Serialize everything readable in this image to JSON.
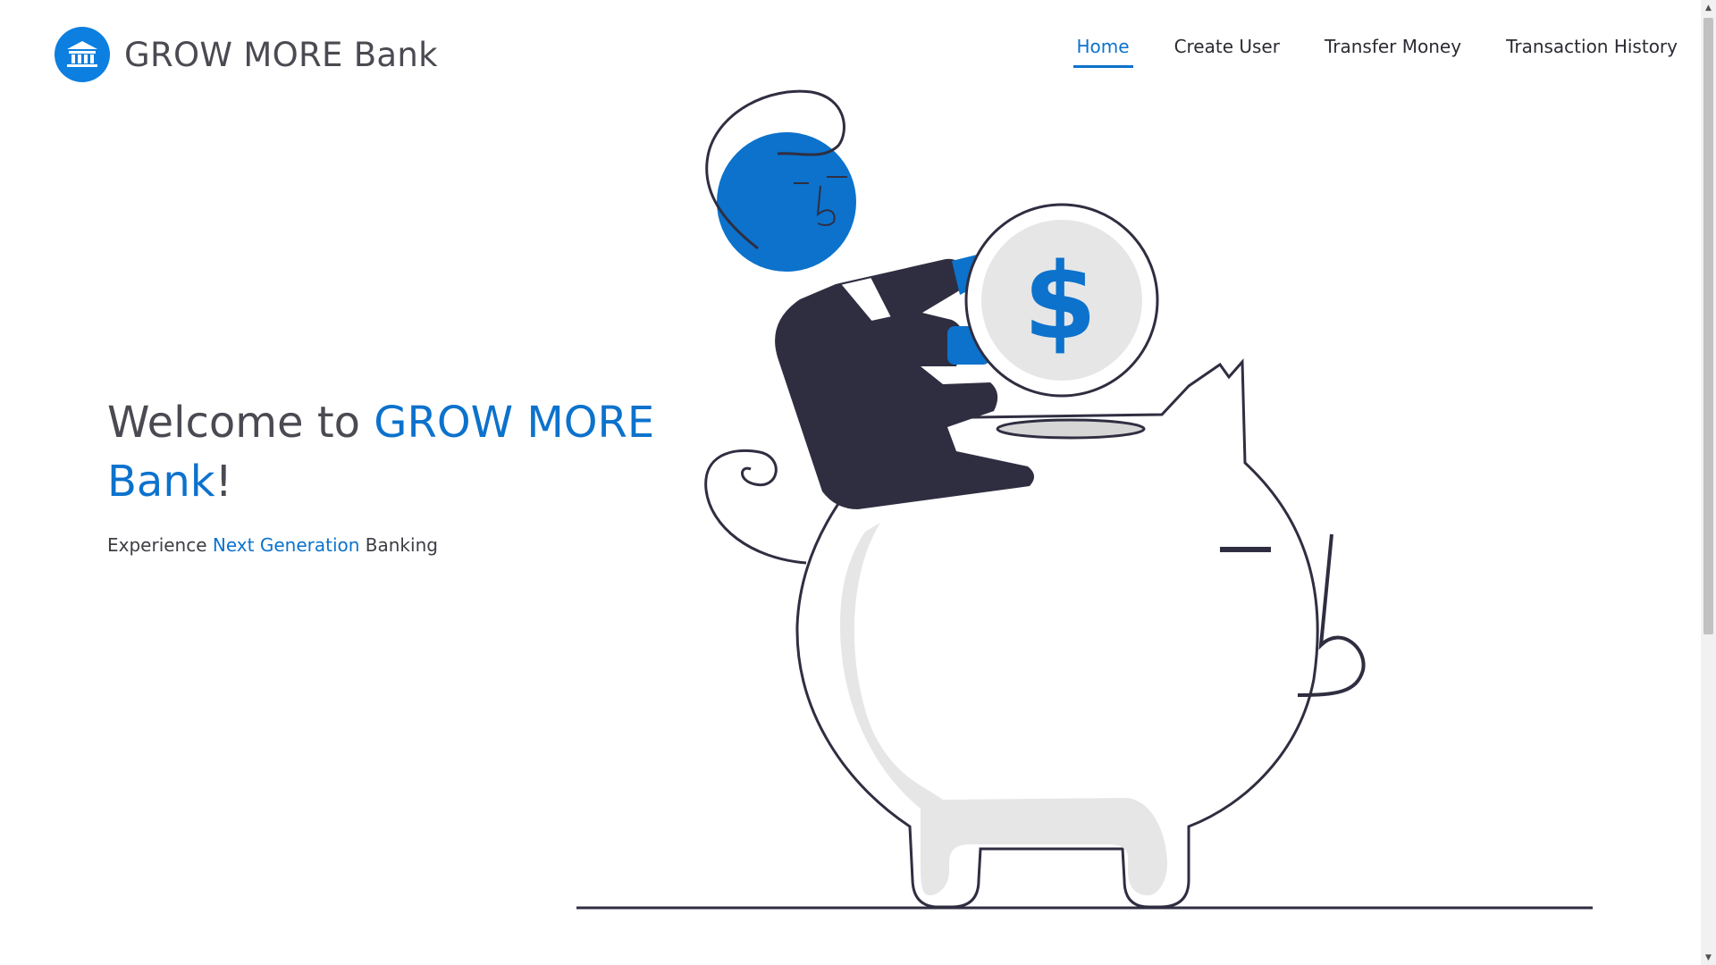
{
  "brand": {
    "logo_icon": "bank-building-icon",
    "name": "GROW MORE Bank"
  },
  "nav": {
    "items": [
      {
        "label": "Home",
        "active": true
      },
      {
        "label": "Create User",
        "active": false
      },
      {
        "label": "Transfer Money",
        "active": false
      },
      {
        "label": "Transaction History",
        "active": false
      }
    ]
  },
  "hero": {
    "title_prefix": "Welcome to ",
    "title_highlight": "GROW MORE Bank",
    "title_suffix": "!",
    "subtitle_prefix": "Experience ",
    "subtitle_highlight": "Next Generation",
    "subtitle_suffix": " Banking"
  },
  "illustration": {
    "icon": "piggy-bank-illustration",
    "coin_symbol": "$"
  },
  "colors": {
    "accent": "#0c72cc",
    "logo": "#0c7fe0",
    "dark": "#2f2e41",
    "light_gray": "#e6e6e6"
  }
}
